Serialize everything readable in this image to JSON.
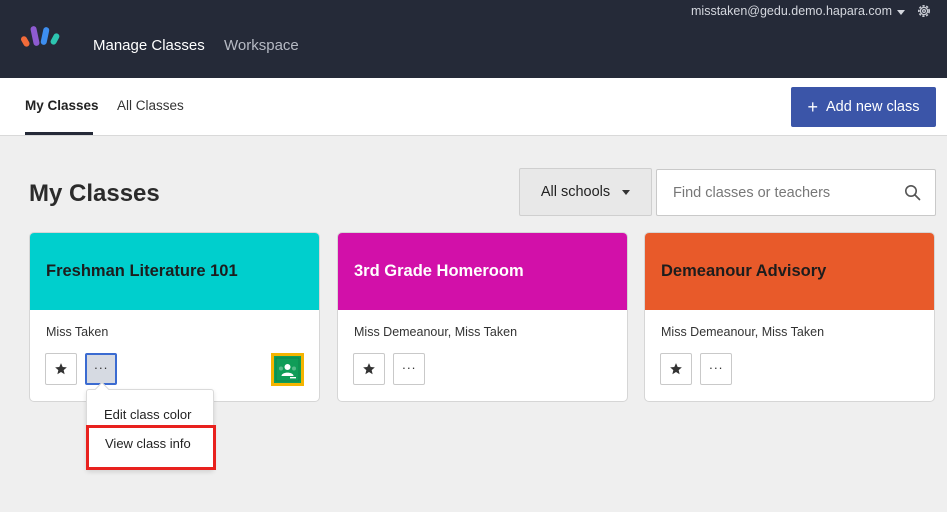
{
  "topbar": {
    "nav": {
      "manage_classes": "Manage Classes",
      "workspace": "Workspace"
    },
    "account_email": "misstaken@gedu.demo.hapara.com",
    "logo_colors": [
      "#f26b3a",
      "#8e5bd1",
      "#3d8ef0",
      "#2dc5b0"
    ]
  },
  "subnav": {
    "tabs": [
      {
        "label": "My Classes",
        "active": true
      },
      {
        "label": "All Classes",
        "active": false
      }
    ],
    "add_button_label": "Add new class"
  },
  "main": {
    "title": "My Classes",
    "school_filter": {
      "selected": "All schools"
    },
    "search": {
      "placeholder": "Find classes or teachers",
      "value": ""
    }
  },
  "cards": [
    {
      "name": "Freshman Literature 101",
      "color": "#00cfcd",
      "teachers": "Miss Taken",
      "has_google_classroom": true,
      "menu_open": true
    },
    {
      "name": "3rd Grade Homeroom",
      "color": "#d210a9",
      "teachers": "Miss Demeanour, Miss Taken",
      "has_google_classroom": false,
      "menu_open": false
    },
    {
      "name": "Demeanour Advisory",
      "color": "#e85a2a",
      "teachers": "Miss Demeanour, Miss Taken",
      "has_google_classroom": false,
      "menu_open": false
    }
  ],
  "card_menu": {
    "items": [
      {
        "label": "Edit class color"
      },
      {
        "label": "View class info",
        "highlighted": true
      }
    ]
  },
  "icons": {
    "star": "star-icon",
    "more": "more-dots-icon",
    "search": "search-icon",
    "settings": "gear-icon",
    "classroom": "google-classroom-icon"
  },
  "colors": {
    "topbar_bg": "#252a38",
    "primary": "#3b55a8",
    "highlight_border": "#e8211e"
  }
}
